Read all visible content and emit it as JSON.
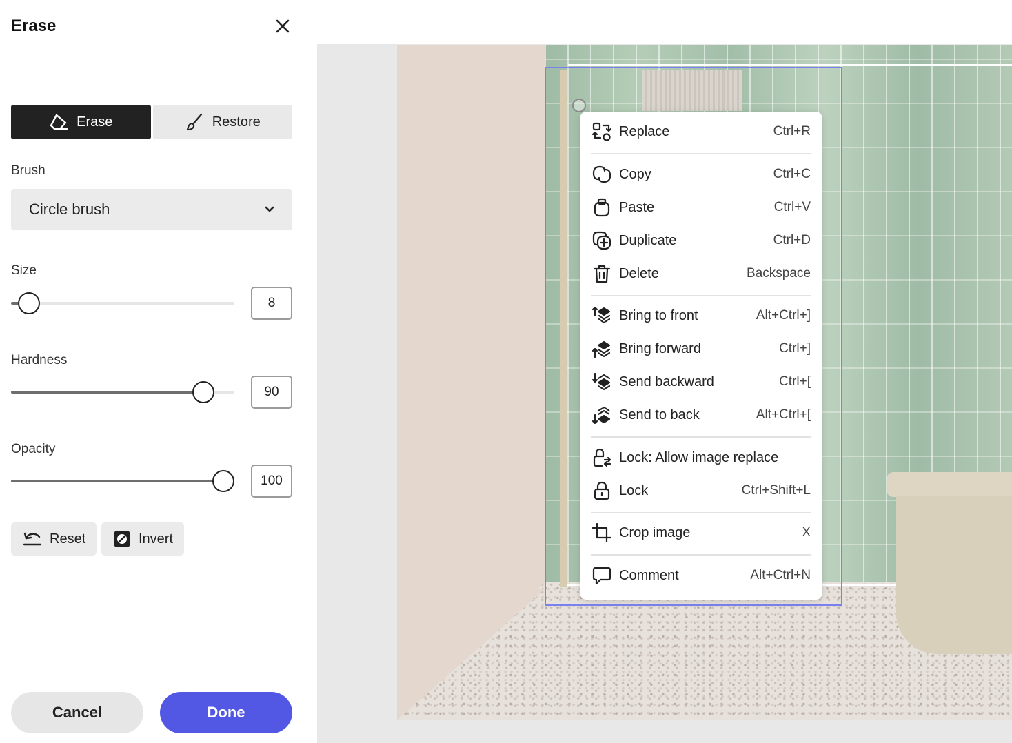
{
  "panel": {
    "title": "Erase",
    "modes": {
      "erase": "Erase",
      "restore": "Restore",
      "active": "erase"
    },
    "brush": {
      "label": "Brush",
      "value": "Circle brush"
    },
    "size": {
      "label": "Size",
      "value": "8",
      "fraction": 0.08
    },
    "hardness": {
      "label": "Hardness",
      "value": "90",
      "fraction": 0.86
    },
    "opacity": {
      "label": "Opacity",
      "value": "100",
      "fraction": 0.95
    },
    "reset_label": "Reset",
    "invert_label": "Invert",
    "cancel_label": "Cancel",
    "done_label": "Done"
  },
  "menu": {
    "items": [
      {
        "label": "Replace",
        "shortcut": "Ctrl+R",
        "icon": "replace-icon"
      },
      {
        "label": "Copy",
        "shortcut": "Ctrl+C",
        "icon": "copy-icon"
      },
      {
        "label": "Paste",
        "shortcut": "Ctrl+V",
        "icon": "paste-icon"
      },
      {
        "label": "Duplicate",
        "shortcut": "Ctrl+D",
        "icon": "duplicate-icon"
      },
      {
        "label": "Delete",
        "shortcut": "Backspace",
        "icon": "trash-icon"
      },
      {
        "label": "Bring to front",
        "shortcut": "Alt+Ctrl+]",
        "icon": "bring-to-front-icon"
      },
      {
        "label": "Bring forward",
        "shortcut": "Ctrl+]",
        "icon": "bring-forward-icon"
      },
      {
        "label": "Send backward",
        "shortcut": "Ctrl+[",
        "icon": "send-backward-icon"
      },
      {
        "label": "Send to back",
        "shortcut": "Alt+Ctrl+[",
        "icon": "send-to-back-icon"
      },
      {
        "label": "Lock: Allow image replace",
        "shortcut": "",
        "icon": "lock-replace-icon"
      },
      {
        "label": "Lock",
        "shortcut": "Ctrl+Shift+L",
        "icon": "lock-icon"
      },
      {
        "label": "Crop image",
        "shortcut": "X",
        "icon": "crop-icon"
      },
      {
        "label": "Comment",
        "shortcut": "Alt+Ctrl+N",
        "icon": "comment-icon"
      }
    ]
  },
  "colors": {
    "accent": "#5258e4",
    "active_segment": "#222222",
    "selection": "#7a80ef"
  }
}
